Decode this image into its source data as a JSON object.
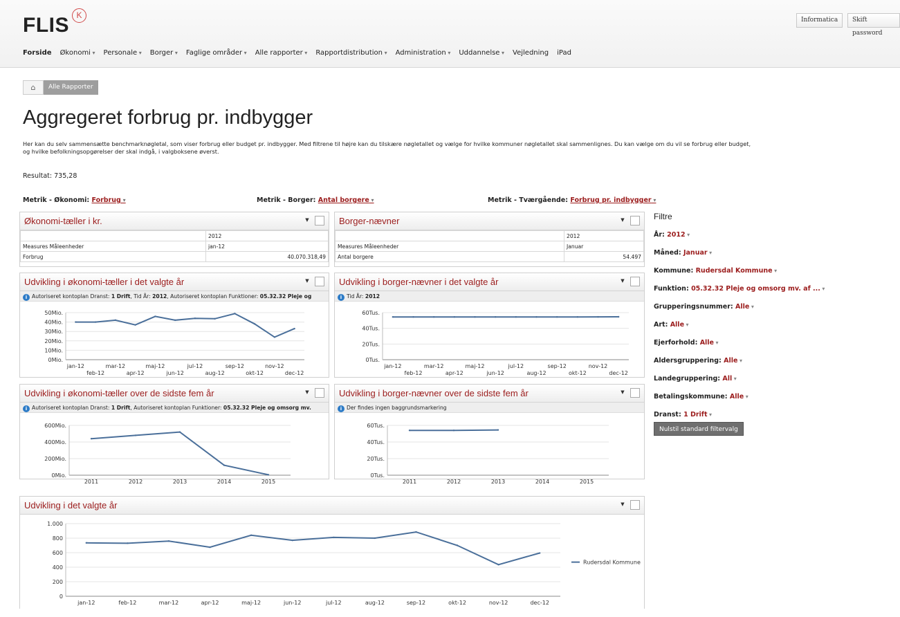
{
  "header": {
    "logo": "FLIS",
    "logo_mark": "K",
    "buttons": [
      "Informatica",
      "Skift password"
    ],
    "nav": [
      "Forside",
      "Økonomi",
      "Personale",
      "Borger",
      "Faglige områder",
      "Alle rapporter",
      "Rapportdistribution",
      "Administration",
      "Uddannelse",
      "Vejledning",
      "iPad"
    ]
  },
  "breadcrumb": {
    "link": "Alle Rapporter"
  },
  "page": {
    "title": "Aggregeret forbrug pr. indbygger",
    "intro_line1": "Her kan du selv sammensætte benchmarknøgletal, som viser forbrug eller budget pr. indbygger. Med filtrene til højre kan du tilskære nøgletallet og vælge for hvilke kommuner nøgletallet skal sammenlignes. Du kan vælge om du vil se forbrug eller budget,",
    "intro_line2": "og hvilke befolkningsopgørelser der skal indgå, i valgboksene øverst.",
    "result_label": "Resultat:",
    "result_value": "735,28"
  },
  "metrics": [
    {
      "label": "Metrik - Økonomi:",
      "value": "Forbrug"
    },
    {
      "label": "Metrik - Borger:",
      "value": "Antal borgere"
    },
    {
      "label": "Metrik - Tværgående:",
      "value": "Forbrug pr. indbygger"
    }
  ],
  "panels": {
    "okonomi_taeller": {
      "title": "Økonomi-tæller i kr.",
      "year": "2012",
      "row_header": "Measures Måleenheder",
      "period": "jan-12",
      "measure": "Forbrug",
      "value": "40.070.318,49"
    },
    "borger_naevner": {
      "title": "Borger-nævner",
      "year": "2012",
      "row_header": "Measures Måleenheder",
      "period": "Januar",
      "measure": "Antal borgere",
      "value": "54.497"
    },
    "udv_okonomi_aar": {
      "title": "Udvikling i økonomi-tæller i det valgte år",
      "info_1": "Autoriseret kontoplan Dranst: ",
      "info_1b": "1 Drift",
      "info_2": ", Tid År: ",
      "info_2b": "2012",
      "info_3": ", Autoriseret kontoplan Funktioner: ",
      "info_3b": "05.32.32 Pleje og"
    },
    "udv_borger_aar": {
      "title": "Udvikling i borger-nævner i det valgte år",
      "info_1": "Tid År: ",
      "info_1b": "2012"
    },
    "udv_okonomi_fem": {
      "title": "Udvikling i økonomi-tæller over de sidste fem år",
      "info_1": "Autoriseret kontoplan Dranst: ",
      "info_1b": "1 Drift",
      "info_2": ", Autoriseret kontoplan Funktioner: ",
      "info_2b": "05.32.32 Pleje og omsorg mv."
    },
    "udv_borger_fem": {
      "title": "Udvikling i borger-nævner over de sidste fem år",
      "info_1": "Der findes ingen baggrundsmarkering"
    },
    "udv_valgte_aar": {
      "title": "Udvikling i det valgte år"
    }
  },
  "filters": {
    "title": "Filtre",
    "items": [
      {
        "label": "År:",
        "value": "2012"
      },
      {
        "label": "Måned:",
        "value": "Januar"
      },
      {
        "label": "Kommune:",
        "value": "Rudersdal Kommune"
      },
      {
        "label": "Funktion:",
        "value": "05.32.32 Pleje og omsorg mv. af ..."
      },
      {
        "label": "Grupperingsnummer:",
        "value": "Alle"
      },
      {
        "label": "Art:",
        "value": "Alle"
      },
      {
        "label": "Ejerforhold:",
        "value": "Alle"
      },
      {
        "label": "Aldersgruppering:",
        "value": "Alle"
      },
      {
        "label": "Landegruppering:",
        "value": "All"
      },
      {
        "label": "Betalingskommune:",
        "value": "Alle"
      },
      {
        "label": "Dranst:",
        "value": "1 Drift"
      }
    ],
    "reset_label": "Nulstil standard filtervalg"
  },
  "colors": {
    "accent": "#9b1c1c",
    "line": "#4a6f9a",
    "info": "#2c7bc7"
  },
  "chart_data": [
    {
      "type": "line",
      "id": "udv-okonomi-aar",
      "categories": [
        "jan-12",
        "feb-12",
        "mar-12",
        "apr-12",
        "maj-12",
        "jun-12",
        "jul-12",
        "aug-12",
        "sep-12",
        "okt-12",
        "nov-12",
        "dec-12"
      ],
      "values": [
        40,
        40,
        42,
        37,
        46,
        42,
        44,
        43.5,
        49,
        38,
        24,
        33
      ],
      "yticks": [
        0,
        10,
        20,
        30,
        40,
        50
      ],
      "ytick_labels": [
        "0Mio.",
        "10Mio.",
        "20Mio.",
        "30Mio.",
        "40Mio.",
        "50Mio."
      ],
      "ylim": [
        0,
        50
      ]
    },
    {
      "type": "line",
      "id": "udv-borger-aar",
      "categories": [
        "jan-12",
        "feb-12",
        "mar-12",
        "apr-12",
        "maj-12",
        "jun-12",
        "jul-12",
        "aug-12",
        "sep-12",
        "okt-12",
        "nov-12",
        "dec-12"
      ],
      "values": [
        54.5,
        54.5,
        54.5,
        54.5,
        54.5,
        54.5,
        54.5,
        54.5,
        54.5,
        54.5,
        54.6,
        54.7
      ],
      "yticks": [
        0,
        20,
        40,
        60
      ],
      "ytick_labels": [
        "0Tus.",
        "20Tus.",
        "40Tus.",
        "60Tus."
      ],
      "ylim": [
        0,
        60
      ]
    },
    {
      "type": "line",
      "id": "udv-okonomi-fem",
      "categories": [
        "2011",
        "2012",
        "2013",
        "2014",
        "2015"
      ],
      "values": [
        440,
        480,
        520,
        120,
        5
      ],
      "yticks": [
        0,
        200,
        400,
        600
      ],
      "ytick_labels": [
        "0Mio.",
        "200Mio.",
        "400Mio.",
        "600Mio."
      ],
      "ylim": [
        0,
        600
      ]
    },
    {
      "type": "line",
      "id": "udv-borger-fem",
      "categories": [
        "2011",
        "2012",
        "2013",
        "2014",
        "2015"
      ],
      "values": [
        54,
        54,
        54.5,
        null,
        null
      ],
      "yticks": [
        0,
        20,
        40,
        60
      ],
      "ytick_labels": [
        "0Tus.",
        "20Tus.",
        "40Tus.",
        "60Tus."
      ],
      "ylim": [
        0,
        60
      ]
    },
    {
      "type": "line",
      "id": "udv-valgte-aar",
      "categories": [
        "jan-12",
        "feb-12",
        "mar-12",
        "apr-12",
        "maj-12",
        "jun-12",
        "jul-12",
        "aug-12",
        "sep-12",
        "okt-12",
        "nov-12",
        "dec-12"
      ],
      "series": [
        {
          "name": "Rudersdal Kommune",
          "values": [
            735,
            730,
            760,
            675,
            840,
            770,
            810,
            800,
            885,
            700,
            435,
            595
          ]
        }
      ],
      "yticks": [
        0,
        200,
        400,
        600,
        800,
        1000
      ],
      "ytick_labels": [
        "0",
        "200",
        "400",
        "600",
        "800",
        "1.000"
      ],
      "ylim": [
        0,
        1000
      ],
      "legend": "right"
    }
  ]
}
